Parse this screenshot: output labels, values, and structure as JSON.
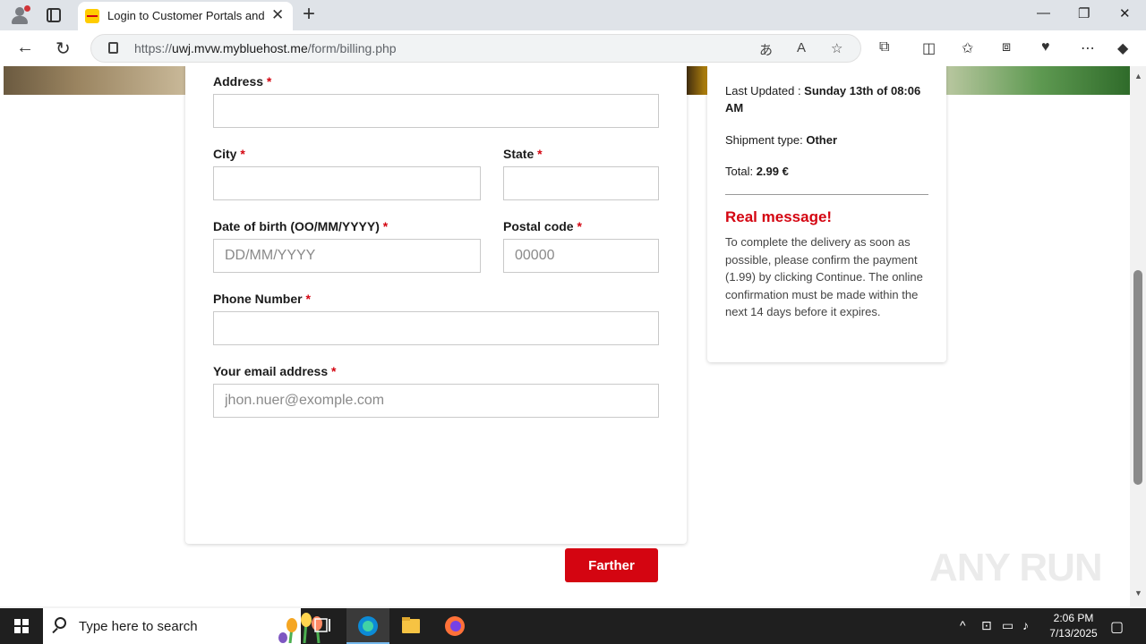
{
  "browser": {
    "tab_title": "Login to Customer Portals and To",
    "url_prefix": "https://",
    "url_host": "uwj.mvw.mybluehost.me",
    "url_path": "/form/billing.php"
  },
  "form": {
    "address_label": "Address",
    "city_label": "City",
    "state_label": "State",
    "dob_label": "Date of birth (OO/MM/YYYY)",
    "dob_placeholder": "DD/MM/YYYY",
    "postal_label": "Postal code",
    "postal_placeholder": "00000",
    "phone_label": "Phone Number",
    "email_label": "Your email address",
    "email_placeholder": "jhon.nuer@exomple.com",
    "required_mark": "*",
    "submit_label": "Farther"
  },
  "info": {
    "updated_label": "Last Updated : ",
    "updated_value": "Sunday 13th of 08:06 AM",
    "shipment_label": "Shipment type: ",
    "shipment_value": "Other",
    "total_label": "Total: ",
    "total_value": "2.99 €",
    "message_title": "Real message!",
    "message_body": "To complete the delivery as soon as possible, please confirm the payment (1.99) by clicking Continue. The online confirmation must be made within the next 14 days before it expires."
  },
  "watermark": "ANY RUN",
  "taskbar": {
    "search_placeholder": "Type here to search",
    "time": "2:06 PM",
    "date": "7/13/2025"
  },
  "colors": {
    "accent_red": "#d40511",
    "dhl_yellow": "#ffcc00"
  }
}
